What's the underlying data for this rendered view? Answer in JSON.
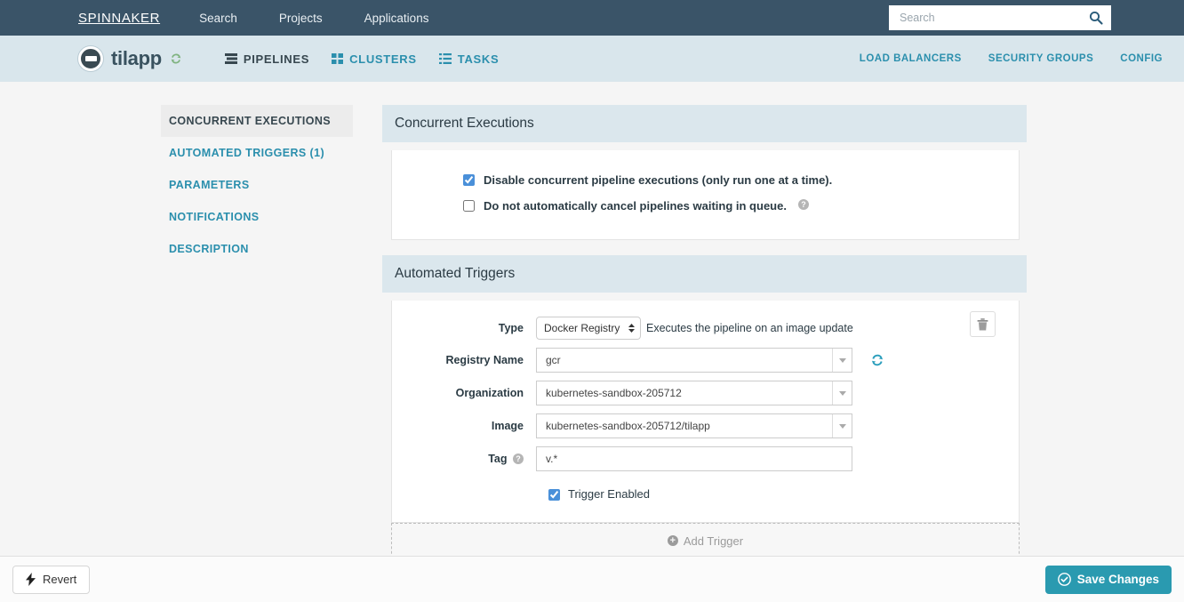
{
  "topnav": {
    "brand": "SPINNAKER",
    "links": [
      {
        "label": "Search"
      },
      {
        "label": "Projects"
      },
      {
        "label": "Applications"
      }
    ],
    "search": {
      "value": "",
      "placeholder": "Search",
      "icon": "search-icon"
    }
  },
  "appnav": {
    "app_name": "tilapp",
    "refresh_icon": "refresh-icon",
    "tabs": [
      {
        "label": "PIPELINES",
        "icon": "pipelines-icon",
        "active": true
      },
      {
        "label": "CLUSTERS",
        "icon": "clusters-icon",
        "active": false
      },
      {
        "label": "TASKS",
        "icon": "tasks-icon",
        "active": false
      }
    ],
    "right_links": [
      {
        "label": "LOAD BALANCERS"
      },
      {
        "label": "SECURITY GROUPS"
      },
      {
        "label": "CONFIG"
      }
    ]
  },
  "sidenav": {
    "items": [
      {
        "label": "CONCURRENT EXECUTIONS",
        "active": true
      },
      {
        "label": "AUTOMATED TRIGGERS (1)",
        "active": false
      },
      {
        "label": "PARAMETERS",
        "active": false
      },
      {
        "label": "NOTIFICATIONS",
        "active": false
      },
      {
        "label": "DESCRIPTION",
        "active": false
      }
    ]
  },
  "concurrent_executions": {
    "title": "Concurrent Executions",
    "options": [
      {
        "label": "Disable concurrent pipeline executions (only run one at a time).",
        "checked": true,
        "help": false
      },
      {
        "label": "Do not automatically cancel pipelines waiting in queue.",
        "checked": false,
        "help": true
      }
    ]
  },
  "automated_triggers": {
    "title": "Automated Triggers",
    "delete_icon": "trash-icon",
    "refresh_icon": "refresh-icon",
    "fields": {
      "type_label": "Type",
      "type_value": "Docker Registry",
      "type_options": [
        "Docker Registry"
      ],
      "type_hint": "Executes the pipeline on an image update",
      "registry_label": "Registry Name",
      "registry_value": "gcr",
      "organization_label": "Organization",
      "organization_value": "kubernetes-sandbox-205712",
      "image_label": "Image",
      "image_value": "kubernetes-sandbox-205712/tilapp",
      "tag_label": "Tag",
      "tag_value": "v.*",
      "tag_placeholder": ""
    },
    "enabled": {
      "label": "Trigger Enabled",
      "checked": true
    },
    "add_trigger": {
      "label": "Add Trigger",
      "icon": "plus-circle-icon"
    }
  },
  "footer": {
    "revert": {
      "label": "Revert",
      "icon": "bolt-icon"
    },
    "save": {
      "label": "Save Changes",
      "icon": "check-circle-icon"
    }
  },
  "colors": {
    "topnav_bg": "#3a5468",
    "appnav_bg": "#d9e6ec",
    "accent_teal": "#2b8fad",
    "save_button": "#2a9ab0",
    "panel_head_bg": "#dbe7ed",
    "page_bg": "#f5f5f5",
    "checkbox_blue": "#4a90d9"
  }
}
